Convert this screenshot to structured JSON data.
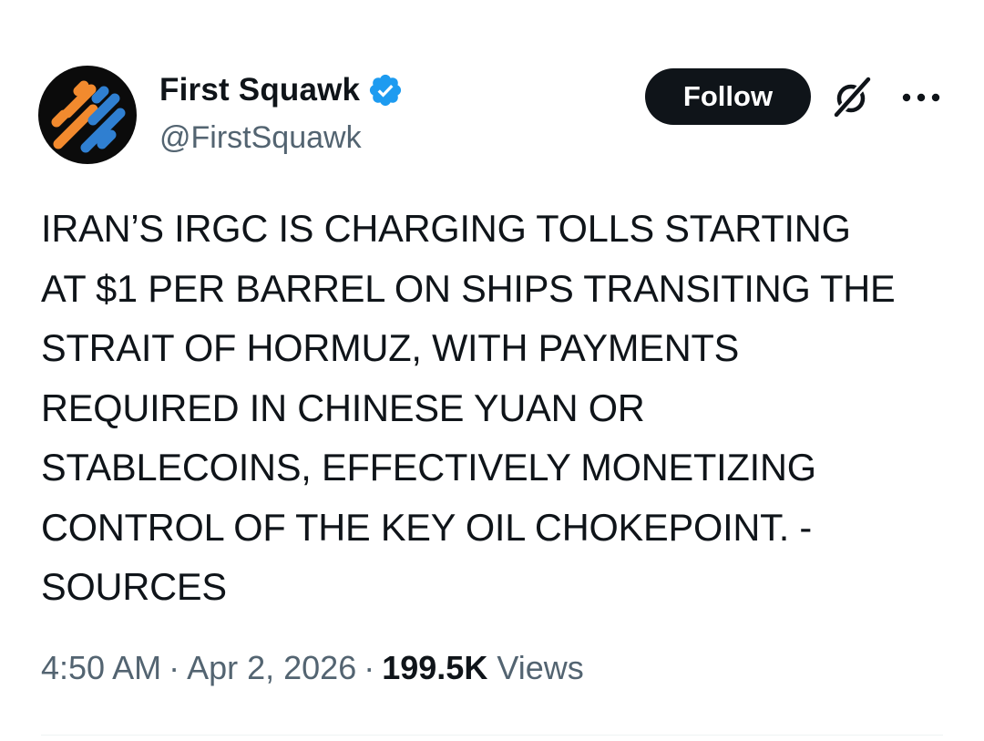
{
  "author": {
    "display_name": "First Squawk",
    "handle": "@FirstSquawk",
    "verified": true,
    "avatar_icon": "first-squawk-logo-icon",
    "avatar_colors": {
      "background": "#0b0b0b",
      "orange": "#f28a2e",
      "blue": "#2f7fd1"
    }
  },
  "actions": {
    "follow_label": "Follow",
    "grok_icon": "grok-icon",
    "more_icon": "more-icon"
  },
  "tweet": {
    "text": "IRAN’S IRGC IS CHARGING TOLLS STARTING\nAT $1 PER BARREL ON SHIPS TRANSITING THE\nSTRAIT OF HORMUZ, WITH PAYMENTS\nREQUIRED IN CHINESE YUAN OR\nSTABLECOINS, EFFECTIVELY MONETIZING\nCONTROL OF THE KEY OIL CHOKEPOINT. -\nSOURCES",
    "time": "4:50 AM",
    "date": "Apr 2, 2026",
    "separator": "·",
    "views_count": "199.5K",
    "views_label": "Views"
  },
  "colors": {
    "text_primary": "#0f1419",
    "text_secondary": "#536471",
    "verified_blue": "#1d9bf0",
    "follow_bg": "#0f1419",
    "divider": "#eff3f4"
  }
}
